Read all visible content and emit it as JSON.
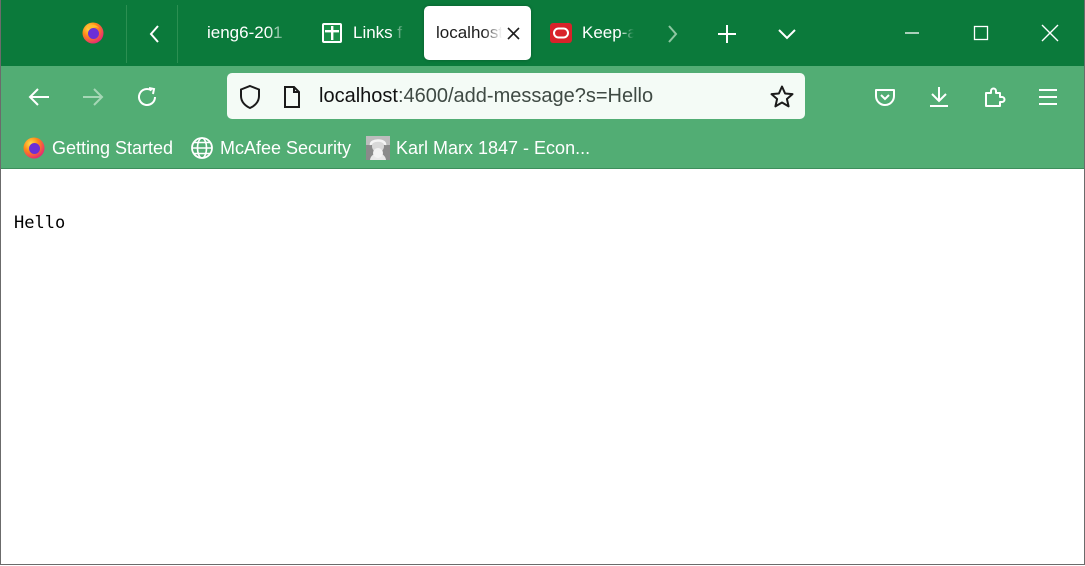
{
  "window": {
    "tabs": [
      {
        "label": "ieng6-201",
        "active": false
      },
      {
        "label": "Links f",
        "active": false
      },
      {
        "label": "localhost",
        "active": true
      },
      {
        "label": "Keep-a",
        "active": false
      }
    ],
    "accent_color": "#0b7a3b",
    "toolbar_color": "#52ad74"
  },
  "urlbar": {
    "host": "localhost",
    "path": ":4600/add-message?s=Hello"
  },
  "bookmarks": [
    {
      "label": "Getting Started",
      "icon": "firefox-icon"
    },
    {
      "label": "McAfee Security",
      "icon": "globe-icon"
    },
    {
      "label": "Karl Marx 1847 - Econ...",
      "icon": "portrait-thumbnail-icon"
    }
  ],
  "page": {
    "message": "Hello"
  }
}
